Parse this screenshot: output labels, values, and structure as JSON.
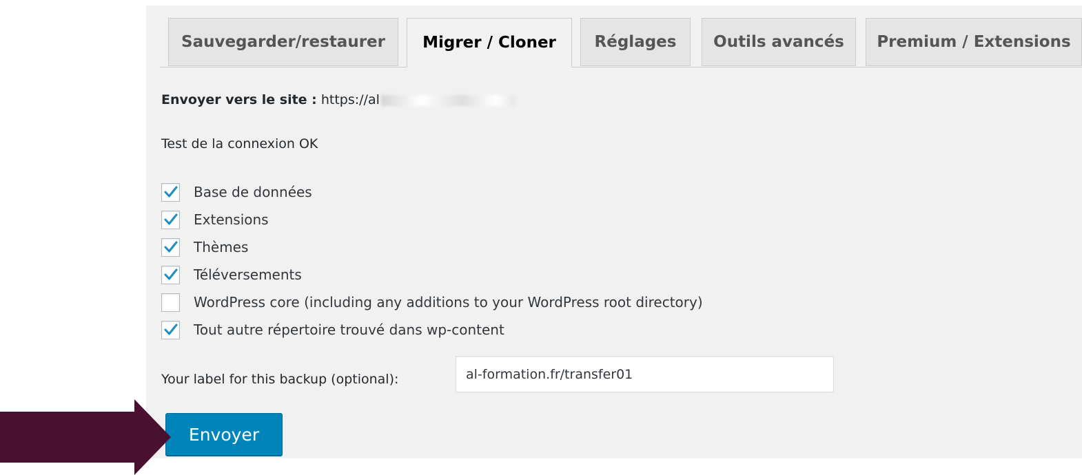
{
  "tabs": [
    {
      "label": "Sauvegarder/restaurer",
      "active": false
    },
    {
      "label": "Migrer / Cloner",
      "active": true
    },
    {
      "label": "Réglages",
      "active": false
    },
    {
      "label": "Outils avancés",
      "active": false
    },
    {
      "label": "Premium / Extensions",
      "active": false
    }
  ],
  "send_site": {
    "label": "Envoyer vers le site :",
    "url": "https://al"
  },
  "connection_status": "Test de la connexion OK",
  "options": [
    {
      "label": "Base de données",
      "checked": true
    },
    {
      "label": "Extensions",
      "checked": true
    },
    {
      "label": "Thèmes",
      "checked": true
    },
    {
      "label": "Téléversements",
      "checked": true
    },
    {
      "label": "WordPress core (including any additions to your WordPress root directory)",
      "checked": false
    },
    {
      "label": "Tout autre répertoire trouvé dans wp-content",
      "checked": true
    }
  ],
  "backup_label": {
    "label": "Your label for this backup (optional):",
    "value": "al-formation.fr/transfer01"
  },
  "send_button": "Envoyer",
  "colors": {
    "button": "#0085ba",
    "checkmark": "#1e8cbe",
    "arrow": "#4a1030"
  },
  "icons": {
    "checkmark": "checkmark-icon",
    "arrow": "arrow-right-icon"
  }
}
